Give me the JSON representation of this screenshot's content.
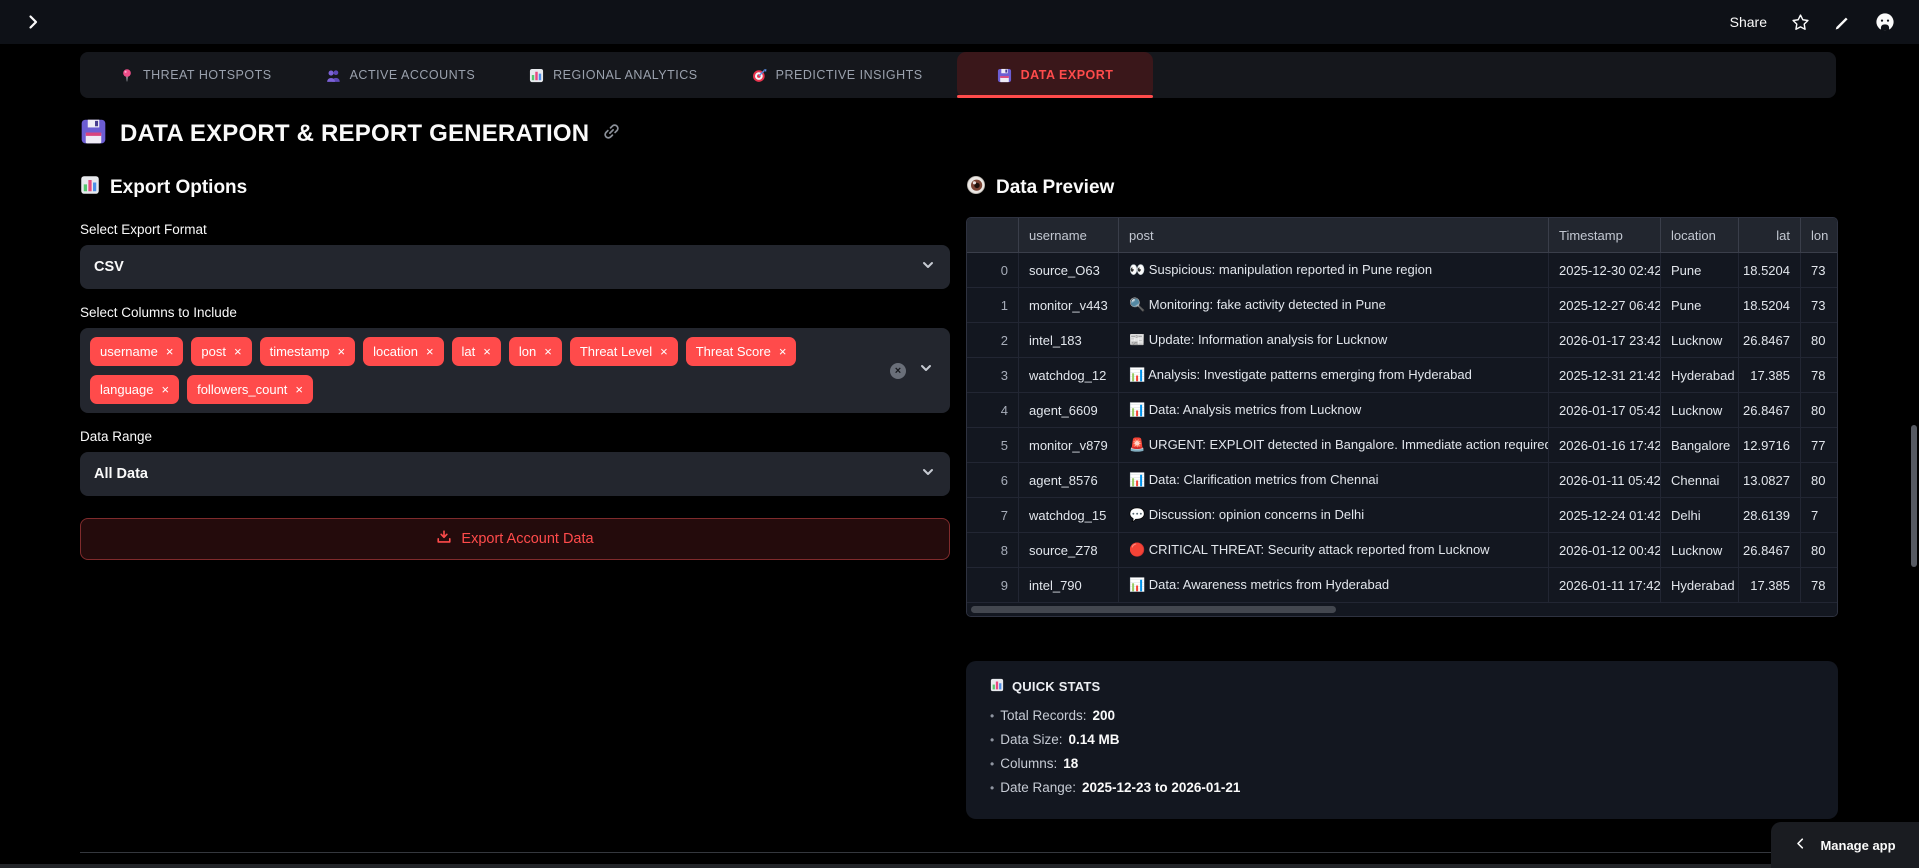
{
  "topbar": {
    "share_label": "Share",
    "icons": [
      "star-icon",
      "pencil-icon",
      "github-icon"
    ]
  },
  "tabs": [
    {
      "label": "THREAT HOTSPOTS",
      "icon": "pin-icon",
      "active": false
    },
    {
      "label": "ACTIVE ACCOUNTS",
      "icon": "people-icon",
      "active": false
    },
    {
      "label": "REGIONAL ANALYTICS",
      "icon": "bar-chart-icon",
      "active": false
    },
    {
      "label": "PREDICTIVE INSIGHTS",
      "icon": "target-icon",
      "active": false
    },
    {
      "label": "DATA EXPORT",
      "icon": "floppy-disk-icon",
      "active": true
    }
  ],
  "page": {
    "title": "DATA EXPORT & REPORT GENERATION",
    "title_icon": "floppy-disk-icon",
    "link_icon": "link-icon"
  },
  "export_options": {
    "section_title": "Export Options",
    "section_icon": "bar-chart-icon",
    "format_label": "Select Export Format",
    "format_value": "CSV",
    "columns_label": "Select Columns to Include",
    "selected_columns": [
      "username",
      "post",
      "timestamp",
      "location",
      "lat",
      "lon",
      "Threat Level",
      "Threat Score",
      "language",
      "followers_count"
    ],
    "range_label": "Data Range",
    "range_value": "All Data",
    "export_button_label": "Export Account Data",
    "export_button_icon": "download-icon"
  },
  "data_preview": {
    "section_title": "Data Preview",
    "section_icon": "eye-icon",
    "columns": [
      "",
      "username",
      "post",
      "Timestamp",
      "location",
      "lat",
      "lon"
    ],
    "rows": [
      [
        "0",
        "source_O63",
        "👀 Suspicious: manipulation reported in Pune region",
        "2025-12-30 02:42",
        "Pune",
        "18.5204",
        "73"
      ],
      [
        "1",
        "monitor_v443",
        "🔍 Monitoring: fake activity detected in Pune",
        "2025-12-27 06:42",
        "Pune",
        "18.5204",
        "73"
      ],
      [
        "2",
        "intel_183",
        "📰 Update: Information analysis for Lucknow",
        "2026-01-17 23:42",
        "Lucknow",
        "26.8467",
        "80"
      ],
      [
        "3",
        "watchdog_12",
        "📊 Analysis: Investigate patterns emerging from Hyderabad",
        "2025-12-31 21:42",
        "Hyderabad",
        "17.385",
        "78"
      ],
      [
        "4",
        "agent_6609",
        "📊 Data: Analysis metrics from Lucknow",
        "2026-01-17 05:42",
        "Lucknow",
        "26.8467",
        "80"
      ],
      [
        "5",
        "monitor_v879",
        "🚨 URGENT: EXPLOIT detected in Bangalore. Immediate action required!",
        "2026-01-16 17:42",
        "Bangalore",
        "12.9716",
        "77"
      ],
      [
        "6",
        "agent_8576",
        "📊 Data: Clarification metrics from Chennai",
        "2026-01-11 05:42",
        "Chennai",
        "13.0827",
        "80"
      ],
      [
        "7",
        "watchdog_15",
        "💬 Discussion: opinion concerns in Delhi",
        "2025-12-24 01:42",
        "Delhi",
        "28.6139",
        "7"
      ],
      [
        "8",
        "source_Z78",
        "🔴 CRITICAL THREAT: Security attack reported from Lucknow",
        "2026-01-12 00:42",
        "Lucknow",
        "26.8467",
        "80"
      ],
      [
        "9",
        "intel_790",
        "📊 Data: Awareness metrics from Hyderabad",
        "2026-01-11 17:42",
        "Hyderabad",
        "17.385",
        "78"
      ]
    ]
  },
  "quick_stats": {
    "title": "QUICK STATS",
    "title_icon": "bar-chart-icon",
    "items": [
      {
        "label": "Total Records:",
        "value": "200"
      },
      {
        "label": "Data Size:",
        "value": "0.14 MB"
      },
      {
        "label": "Columns:",
        "value": "18"
      },
      {
        "label": "Date Range:",
        "value": "2025-12-23 to 2026-01-21"
      }
    ]
  },
  "manage_app": {
    "label": "Manage app"
  },
  "colors": {
    "accent_red": "#ff4b4b",
    "active_tab_background": "#3a171a",
    "header_background": "#0e1117",
    "panel_background": "#131720",
    "page_background": "#000000",
    "tag_background": "#ff4b4b"
  }
}
